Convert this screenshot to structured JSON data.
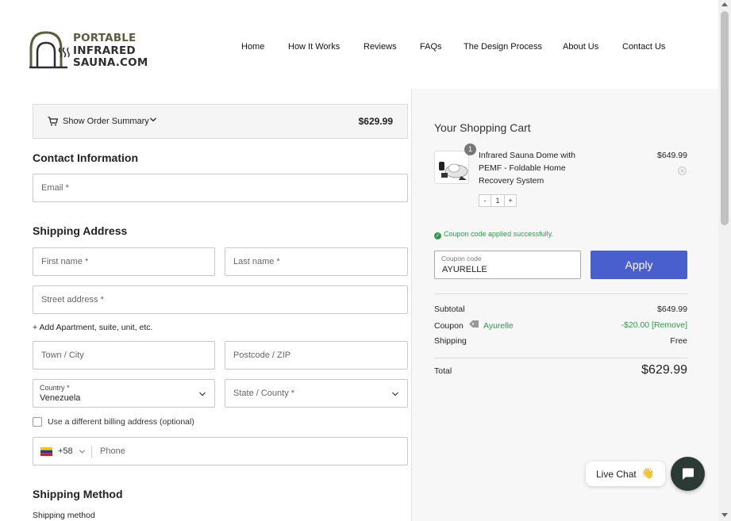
{
  "header": {
    "logo_lines": [
      "PORTABLE",
      "INFRARED",
      "SAUNA.COM"
    ],
    "nav": [
      "Home",
      "How It Works",
      "Reviews",
      "FAQs",
      "The Design Process",
      "About Us",
      "Contact Us"
    ]
  },
  "order_summary_bar": {
    "label": "Show Order Summary",
    "price": "$629.99",
    "icon": "cart-icon"
  },
  "contact": {
    "title": "Contact Information",
    "email_placeholder": "Email *"
  },
  "shipping_address": {
    "title": "Shipping Address",
    "first_name_placeholder": "First name *",
    "last_name_placeholder": "Last name *",
    "street_placeholder": "Street address *",
    "add_apartment": "+ Add Apartment, suite, unit, etc.",
    "town_placeholder": "Town / City",
    "postcode_placeholder": "Postcode / ZIP",
    "country_label": "Country *",
    "country_value": "Venezuela",
    "state_placeholder": "State / County *",
    "billing_checkbox_label": "Use a different billing address (optional)",
    "phone_code": "+58",
    "phone_placeholder": "Phone"
  },
  "shipping_method": {
    "title": "Shipping Method",
    "label": "Shipping method"
  },
  "cart": {
    "title": "Your Shopping Cart",
    "item": {
      "name": "Infrared Sauna Dome with PEMF - Foldable Home Recovery System",
      "price": "$649.99",
      "quantity": "1",
      "badge": "1",
      "qty_minus": "-",
      "qty_plus": "+"
    },
    "coupon_success": "Coupon code applied successfully.",
    "coupon_label": "Coupon code",
    "coupon_value": "AYURELLE",
    "apply_label": "Apply",
    "subtotal_label": "Subtotal",
    "subtotal_value": "$649.99",
    "coupon_row_label": "Coupon",
    "coupon_name": "Ayurelle",
    "coupon_discount": "-$20.00 [Remove]",
    "shipping_label": "Shipping",
    "shipping_value": "Free",
    "total_label": "Total",
    "total_value": "$629.99"
  },
  "chat": {
    "live_chat_label": "Live Chat",
    "wave": "👋"
  },
  "colors": {
    "apply_button": "#4a5fce",
    "success_green": "#2d9a4a",
    "chat_button": "#2b3a35"
  }
}
